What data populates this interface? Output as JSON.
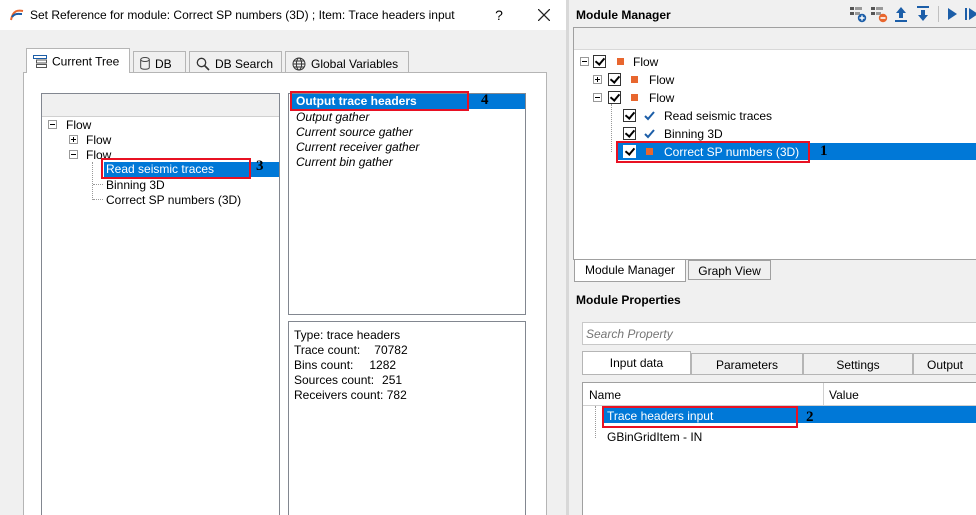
{
  "dialog": {
    "title": "Set Reference for module: Correct SP numbers (3D) ; Item: Trace headers input",
    "help_label": "?",
    "tabs": [
      {
        "label": "Current Tree",
        "icon": "tree-icon",
        "active": true
      },
      {
        "label": "DB",
        "icon": "database-icon",
        "active": false
      },
      {
        "label": "DB Search",
        "icon": "search-icon",
        "active": false
      },
      {
        "label": "Global Variables",
        "icon": "globe-icon",
        "active": false
      }
    ],
    "tree": [
      {
        "label": "Flow",
        "level": 0,
        "expander": "minus"
      },
      {
        "label": "Flow",
        "level": 1,
        "expander": "plus"
      },
      {
        "label": "Flow",
        "level": 1,
        "expander": "minus"
      },
      {
        "label": "Read seismic traces",
        "level": 2,
        "selected": true
      },
      {
        "label": "Binning 3D",
        "level": 2
      },
      {
        "label": "Correct SP numbers (3D)",
        "level": 2
      }
    ],
    "gathers": [
      {
        "label": "Output trace headers",
        "selected": true
      },
      {
        "label": "Output gather"
      },
      {
        "label": "Current source gather"
      },
      {
        "label": "Current receiver gather"
      },
      {
        "label": "Current bin gather"
      }
    ],
    "info": [
      {
        "label": "Type:",
        "value": "trace headers"
      },
      {
        "label": "Trace count:",
        "value": "70782"
      },
      {
        "label": "Bins count:",
        "value": "1282"
      },
      {
        "label": "Sources count:",
        "value": "251"
      },
      {
        "label": "Receivers count:",
        "value": "782"
      }
    ]
  },
  "module_manager": {
    "title": "Module Manager",
    "toolbar_icons": [
      "add-module-icon",
      "remove-module-icon",
      "move-up-icon",
      "move-down-icon",
      "run-icon",
      "run-to-end-icon"
    ],
    "tree": [
      {
        "label": "Flow",
        "level": 0,
        "expander": "minus"
      },
      {
        "label": "Flow",
        "level": 1,
        "expander": "plus"
      },
      {
        "label": "Flow",
        "level": 1,
        "expander": "minus"
      },
      {
        "label": "Read seismic traces",
        "level": 2,
        "status": "check"
      },
      {
        "label": "Binning 3D",
        "level": 2,
        "status": "check"
      },
      {
        "label": "Correct SP numbers (3D)",
        "level": 2,
        "status": "square",
        "selected": true
      }
    ],
    "bottom_tabs": [
      {
        "label": "Module Manager",
        "active": true
      },
      {
        "label": "Graph View",
        "active": false
      }
    ]
  },
  "module_properties": {
    "title": "Module Properties",
    "search_placeholder": "Search Property",
    "tabs": [
      "Input data",
      "Parameters",
      "Settings",
      "Output"
    ],
    "columns": [
      "Name",
      "Value"
    ],
    "rows": [
      {
        "name": "Trace headers input",
        "value": "",
        "selected": true
      },
      {
        "name": "GBinGridItem - IN",
        "value": ""
      }
    ]
  },
  "annotations": [
    "1",
    "2",
    "3",
    "4"
  ],
  "colors": {
    "selection": "#0078d7",
    "highlight_box": "#e81123",
    "module_square": "#e8662e",
    "accent_icon": "#1c5ea8"
  }
}
